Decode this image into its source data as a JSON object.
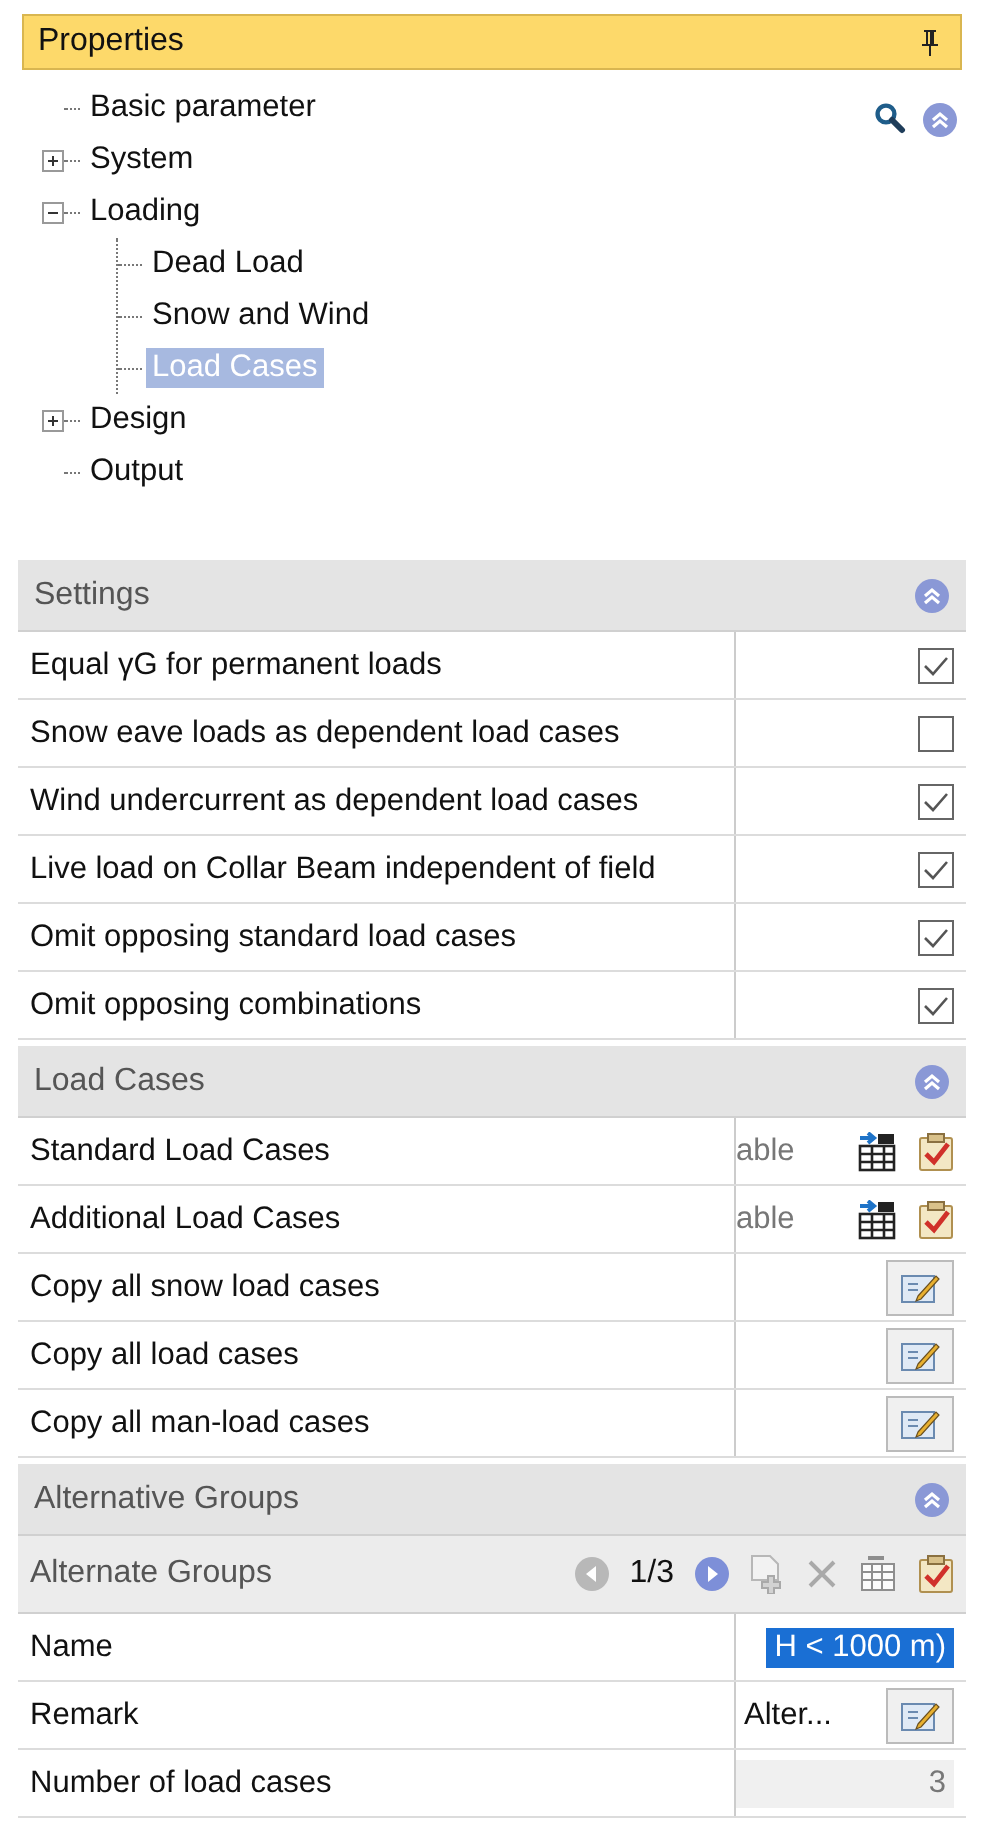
{
  "panel": {
    "title": "Properties"
  },
  "tree": [
    {
      "label": "Basic parameter",
      "selected": false
    },
    {
      "label": "System",
      "expanded": false,
      "selected": false
    },
    {
      "label": "Loading",
      "expanded": true,
      "selected": false,
      "children": [
        {
          "label": "Dead Load",
          "selected": false
        },
        {
          "label": "Snow and Wind",
          "selected": false
        },
        {
          "label": "Load Cases",
          "selected": true
        }
      ]
    },
    {
      "label": "Design",
      "expanded": false,
      "selected": false
    },
    {
      "label": "Output",
      "selected": false
    }
  ],
  "sections": [
    {
      "title": "Settings",
      "rows": [
        {
          "kind": "checkbox",
          "label": "Equal γG for permanent loads",
          "checked": true
        },
        {
          "kind": "checkbox",
          "label": "Snow eave loads as dependent load cases",
          "checked": false
        },
        {
          "kind": "checkbox",
          "label": "Wind undercurrent as dependent load cases",
          "checked": true
        },
        {
          "kind": "checkbox",
          "label": "Live load on Collar Beam independent of field",
          "checked": true
        },
        {
          "kind": "checkbox",
          "label": "Omit opposing standard load cases",
          "checked": true
        },
        {
          "kind": "checkbox",
          "label": "Omit opposing combinations",
          "checked": true
        }
      ]
    },
    {
      "title": "Load Cases",
      "rows": [
        {
          "kind": "table",
          "label": "Standard Load Cases",
          "value": "able"
        },
        {
          "kind": "table",
          "label": "Additional Load Cases",
          "value": "able"
        },
        {
          "kind": "edit",
          "label": "Copy all snow load cases"
        },
        {
          "kind": "edit",
          "label": "Copy all load cases"
        },
        {
          "kind": "edit",
          "label": "Copy all man-load cases"
        }
      ]
    },
    {
      "title": "Alternative Groups",
      "navigator": {
        "label": "Alternate Groups",
        "page": "1/3",
        "tools": [
          {
            "kind": "prev",
            "disabled": true
          },
          {
            "kind": "page"
          },
          {
            "kind": "next",
            "disabled": false
          },
          {
            "kind": "add",
            "disabled": true
          },
          {
            "kind": "delete",
            "disabled": true
          },
          {
            "kind": "table",
            "disabled": true
          },
          {
            "kind": "check",
            "disabled": false
          }
        ]
      },
      "rows": [
        {
          "kind": "input",
          "label": "Name",
          "value": "H < 1000 m)"
        },
        {
          "kind": "edit",
          "label": "Remark",
          "value": "Alter..."
        },
        {
          "kind": "readonly",
          "label": "Number of load cases",
          "value": "3"
        }
      ]
    }
  ]
}
